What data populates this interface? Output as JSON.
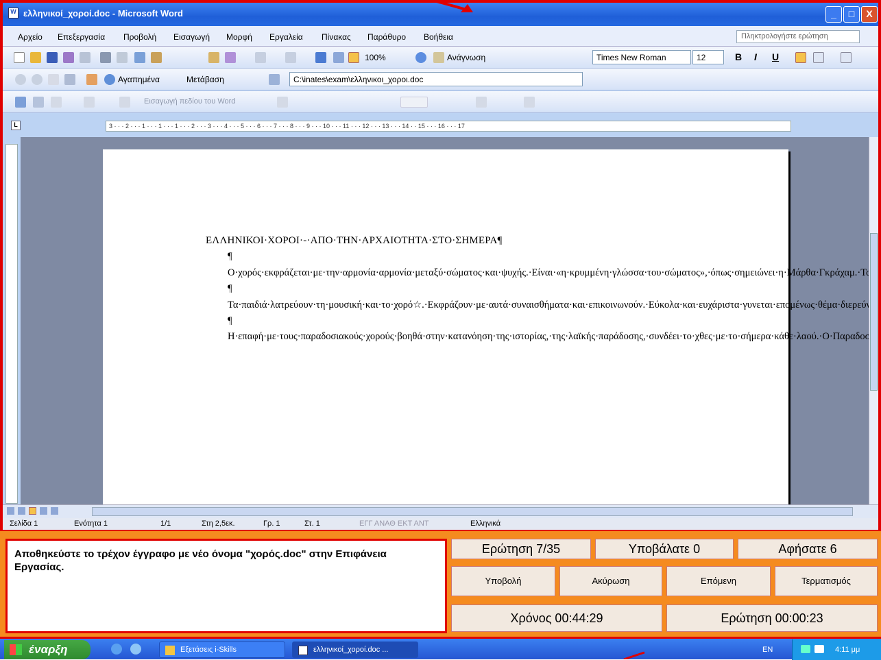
{
  "window": {
    "title": "ελληνικοί_χοροί.doc - Microsoft Word",
    "minimize": "_",
    "maximize": "□",
    "close": "X"
  },
  "menu": {
    "items": [
      "Αρχείο",
      "Επεξεργασία",
      "Προβολή",
      "Εισαγωγή",
      "Μορφή",
      "Εργαλεία",
      "Πίνακας",
      "Παράθυρο",
      "Βοήθεια"
    ],
    "ask_placeholder": "Πληκτρολογήστε ερώτηση"
  },
  "toolbar": {
    "zoom": "100%",
    "read_label": "Ανάγνωση",
    "font_name": "Times New Roman",
    "font_size": "12",
    "bold": "B",
    "italic": "I",
    "underline": "U"
  },
  "web_toolbar": {
    "favorites": "Αγαπημένα",
    "goto": "Μετάβαση",
    "address": "C:\\inates\\exam\\ελληνικοι_χοροι.doc"
  },
  "forms_toolbar": {
    "insert_field": "Εισαγωγή πεδίου του Word"
  },
  "ruler": {
    "text": "3 · · · 2 · · · 1 · · · 1 · · · 1 · · · 2 · · · 3 · · · 4 · · · 5 · · · 6 · · · 7 · · · 8 · · · 9 · · · 10 · · · 11 · · · 12 · · · 13 · · · 14 · · 15 · · · 16 · · · 17"
  },
  "document": {
    "title": "ΕΛΛΗΝΙΚΟΙ·ΧΟΡΟΙ·-·ΑΠΟ·ΤΗΝ·ΑΡΧΑΙΟΤΗΤΑ·ΣΤΟ·ΣΗΜΕΡΑ¶",
    "pilcrow": "¶",
    "p1": "Ο·χορός·εκφράζεται·με·την·αρμονία·αρμονία·μεταξύ·σώματος·και·ψυχής.·Είναι·«η·κρυμμένη·γλώσσα·του·σώματος»,·όπως·σημειώνει·η·Μάρθα·Γκράχαμ.·Τα·πάντα·στο·σσσσύμπαν·έχουν·ρυθμό,·τα·πάντα·χορεύουν·αέναα·στο·άπειρο.·Ο·χορός·είναι·στενά·συνδεδεμένος·με·την·ποίηση,·το·θέατρο·και·κυρίως·τη·μουσική.·¶",
    "p2": "Τα·παιδιά·λατρεύουν·τη·μουσική·και·το·χορό☆.·Εκφράζουν·με·αυτά·συναισθήματα·και·επικοινωνούν.·Εύκολα·και·ευχάριστα·γυνεται·επομένως·θέμα·διερεύνησης·και·αααντικείμενο·διδασκαλίας·από·τους·μαθητές.·Εμπλέκει·διάφορα·γνωστικά·αντικείμενα·και·προσφέρεται·για·διαθεματική·προσέγγιση.¶",
    "p3": "Η·επαφή·με·τους·παραδοσιακούς·χορούς·βοηθά·στην·κατανόηση·της·ιστορίας,·της·λαϊκής·παράδοσης,·συνδέει·το·χθες·με·το·σήμερα·κάθε·λαού.·Ο·Παραδοσιακός·χορός·έφτασε·μέχρι·τις·μέρες·μας·μεταδιδόμενος·από·γενιά·σε·γενιά·μαζί·με·την·παραδοσιακή·μας·μουσική·και·όλο·το·σύστημα·αξιών·που·χαρακτηρίζει·ένα·έθνος.·Στη·σύγχρονη·κοινωνία·η·γνώση·του·εαυτού·μας,·της·ιστορίας·μας·και·ο·σεβασμός·"
  },
  "status": {
    "page": "Σελίδα 1",
    "section": "Ενότητα 1",
    "pages": "1/1",
    "at": "Στη 2,5εκ.",
    "line": "Γρ. 1",
    "col": "Στ. 1",
    "flags": "ΕΓΓ  ΑΝΑΘ  ΕΚΤ  ΑΝΤ",
    "lang": "Ελληνικά"
  },
  "exam": {
    "question_text": "Αποθηκεύστε το τρέχον έγγραφο με νέο όνομα \"χορός.doc\" στην Επιφάνεια Εργασίας.",
    "question_counter": "Ερώτηση 7/35",
    "submitted": "Υποβάλατε 0",
    "left": "Αφήσατε 6",
    "submit": "Υποβολή",
    "cancel": "Ακύρωση",
    "next": "Επόμενη",
    "finish": "Τερματισμός",
    "time_total": "Χρόνος 00:44:29",
    "time_question": "Ερώτηση 00:00:23"
  },
  "taskbar": {
    "start": "έναρξη",
    "task1": "Εξετάσεις i-Skills",
    "task2": "ελληνικοί_χοροί.doc ...",
    "lang": "EN",
    "clock": "4:11 μμ"
  },
  "colors": {
    "frame_red": "#e00000",
    "exam_orange": "#f58b1f",
    "xp_blue": "#2556d3"
  }
}
